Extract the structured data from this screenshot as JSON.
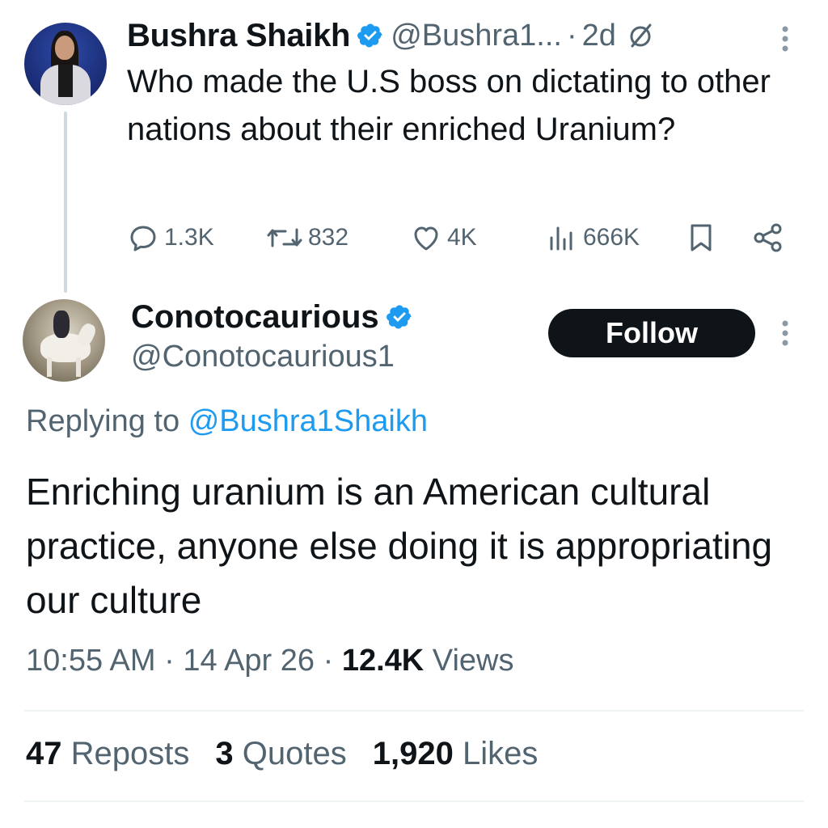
{
  "parent_tweet": {
    "author_name": "Bushra Shaikh",
    "handle": "@Bushra1...",
    "separator": "·",
    "time": "2d",
    "text": "Who made the U.S boss on dictating to other nations about their enriched Uranium?",
    "actions": {
      "replies": "1.3K",
      "reposts": "832",
      "likes": "4K",
      "views": "666K"
    }
  },
  "reply_tweet": {
    "author_name": "Conotocaurious",
    "handle": "@Conotocaurious1",
    "follow_label": "Follow",
    "replying_prefix": "Replying to",
    "replying_mention": "@Bushra1Shaikh",
    "text": "Enriching uranium is an American cultural practice, anyone else doing it is appropriating our culture",
    "timestamp": "10:55 AM",
    "date": "14 Apr 26",
    "separator": "·",
    "views_count": "12.4K",
    "views_label": "Views",
    "stats": {
      "reposts_count": "47",
      "reposts_label": "Reposts",
      "quotes_count": "3",
      "quotes_label": "Quotes",
      "likes_count": "1,920",
      "likes_label": "Likes"
    }
  },
  "colors": {
    "text_primary": "#0f1419",
    "text_secondary": "#536471",
    "link": "#1d9bf0",
    "verified": "#1d9bf0",
    "follow_button": "#0f1419"
  }
}
